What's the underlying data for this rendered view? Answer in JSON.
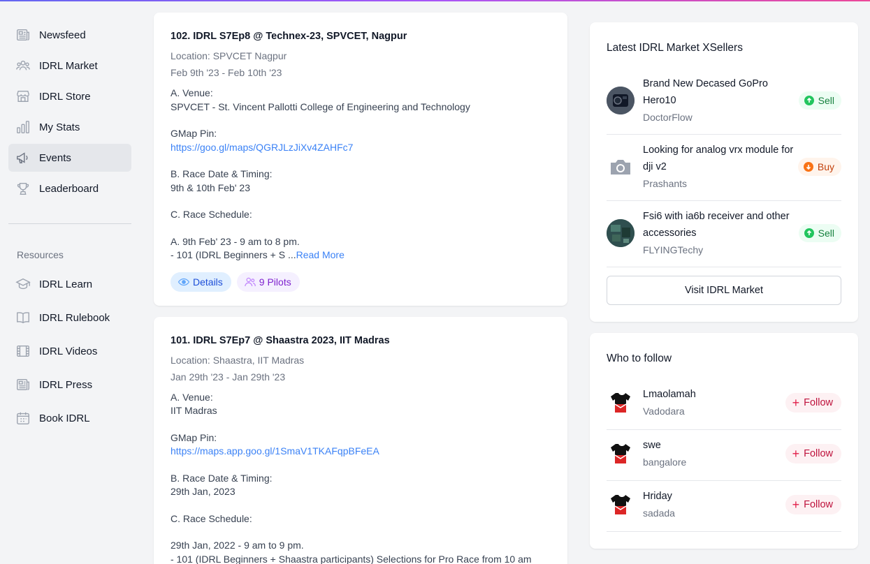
{
  "sidebar": {
    "items": [
      {
        "label": "Newsfeed"
      },
      {
        "label": "IDRL Market"
      },
      {
        "label": "IDRL Store"
      },
      {
        "label": "My Stats"
      },
      {
        "label": "Events"
      },
      {
        "label": "Leaderboard"
      }
    ],
    "resources_label": "Resources",
    "resources": [
      {
        "label": "IDRL Learn"
      },
      {
        "label": "IDRL Rulebook"
      },
      {
        "label": "IDRL Videos"
      },
      {
        "label": "IDRL Press"
      },
      {
        "label": "Book IDRL"
      }
    ]
  },
  "events": [
    {
      "title": "102. IDRL S7Ep8 @ Technex-23, SPVCET, Nagpur",
      "location": "Location: SPVCET Nagpur",
      "dates": "Feb 9th '23 - Feb 10th '23",
      "venue_heading": "A. Venue:",
      "venue": "SPVCET - St. Vincent Pallotti College of Engineering and Technology",
      "gmap_heading": "GMap Pin:",
      "gmap_link": "https://goo.gl/maps/QGRJLzJiXv4ZAHFc7",
      "timing_heading": "B. Race Date & Timing:",
      "timing": "9th & 10th Feb' 23",
      "schedule_heading": "C. Race Schedule:",
      "schedule_line1": "A. 9th Feb' 23 - 9 am to 8 pm.",
      "schedule_line2": "- 101 (IDRL Beginners + S ...",
      "read_more": "Read More",
      "details_label": "Details",
      "pilots_label": "9 Pilots"
    },
    {
      "title": "101. IDRL S7Ep7 @ Shaastra 2023, IIT Madras",
      "location": "Location: Shaastra, IIT Madras",
      "dates": "Jan 29th '23 - Jan 29th '23",
      "venue_heading": "A. Venue:",
      "venue": "IIT Madras",
      "gmap_heading": "GMap Pin:",
      "gmap_link": "https://maps.app.goo.gl/1SmaV1TKAFqpBFeEA",
      "timing_heading": "B. Race Date & Timing:",
      "timing": "29th Jan, 2023",
      "schedule_heading": "C. Race Schedule:",
      "schedule_line1": "29th Jan, 2022 - 9 am to 9 pm.",
      "schedule_line2": "- 101 (IDRL Beginners + Shaastra participants) Selections for Pro Race from 10 am"
    }
  ],
  "market": {
    "title": "Latest IDRL Market XSellers",
    "items": [
      {
        "name": "Brand New Decased GoPro Hero10",
        "user": "DoctorFlow",
        "tag": "Sell"
      },
      {
        "name": "Looking for analog vrx module for dji v2",
        "user": "Prashants",
        "tag": "Buy"
      },
      {
        "name": "Fsi6 with ia6b receiver and other accessories",
        "user": "FLYINGTechy",
        "tag": "Sell"
      }
    ],
    "visit_label": "Visit IDRL Market"
  },
  "follow": {
    "title": "Who to follow",
    "button_label": "Follow",
    "items": [
      {
        "name": "Lmaolamah",
        "location": "Vadodara"
      },
      {
        "name": "swe",
        "location": "bangalore"
      },
      {
        "name": "Hriday",
        "location": "sadada"
      }
    ]
  }
}
